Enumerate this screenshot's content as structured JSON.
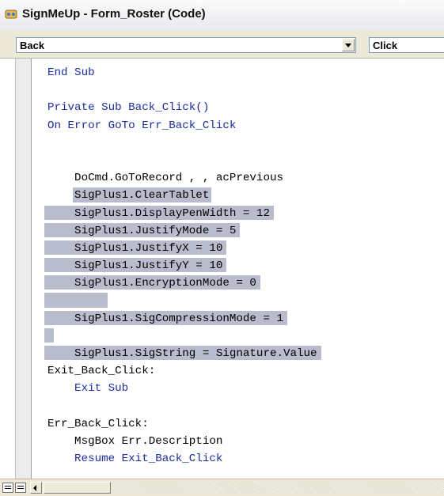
{
  "window": {
    "title": "SignMeUp - Form_Roster (Code)",
    "icon": "vba-module-icon"
  },
  "toolbar": {
    "object_combo": "Back",
    "procedure_combo": "Click"
  },
  "code_lines": [
    {
      "text": "End Sub",
      "highlight": false,
      "keyword": true
    },
    {
      "text": "",
      "highlight": false,
      "keyword": false
    },
    {
      "text": "Private Sub Back_Click()",
      "highlight": false,
      "keyword": true
    },
    {
      "text": "On Error GoTo Err_Back_Click",
      "highlight": false,
      "keyword": true
    },
    {
      "text": "",
      "highlight": false,
      "keyword": false
    },
    {
      "text": "",
      "highlight": false,
      "keyword": false
    },
    {
      "text": "    DoCmd.GoToRecord , , acPrevious",
      "highlight": false,
      "keyword": false
    },
    {
      "text": "    SigPlus1.ClearTablet",
      "highlight": true,
      "keyword": false
    },
    {
      "text": "    SigPlus1.DisplayPenWidth = 12",
      "highlight": true,
      "keyword": false
    },
    {
      "text": "    SigPlus1.JustifyMode = 5",
      "highlight": true,
      "keyword": false
    },
    {
      "text": "    SigPlus1.JustifyX = 10",
      "highlight": true,
      "keyword": false
    },
    {
      "text": "    SigPlus1.JustifyY = 10",
      "highlight": true,
      "keyword": false
    },
    {
      "text": "    SigPlus1.EncryptionMode = 0",
      "highlight": true,
      "keyword": false
    },
    {
      "text": "",
      "highlight": true,
      "keyword": false
    },
    {
      "text": "    SigPlus1.SigCompressionMode = 1",
      "highlight": true,
      "keyword": false
    },
    {
      "text": "",
      "highlight": true,
      "keyword": false
    },
    {
      "text": "    SigPlus1.SigString = Signature.Value",
      "highlight": true,
      "keyword": false
    },
    {
      "text": "Exit_Back_Click:",
      "highlight": false,
      "keyword": false
    },
    {
      "text": "    Exit Sub",
      "highlight": false,
      "keyword": true
    },
    {
      "text": "",
      "highlight": false,
      "keyword": false
    },
    {
      "text": "Err_Back_Click:",
      "highlight": false,
      "keyword": false
    },
    {
      "text": "    MsgBox Err.Description",
      "highlight": false,
      "keyword": false
    },
    {
      "text": "    Resume Exit_Back_Click",
      "highlight": false,
      "keyword": true
    }
  ],
  "statusbar": {
    "buttons": [
      "procedure-view",
      "full-module-view"
    ]
  }
}
